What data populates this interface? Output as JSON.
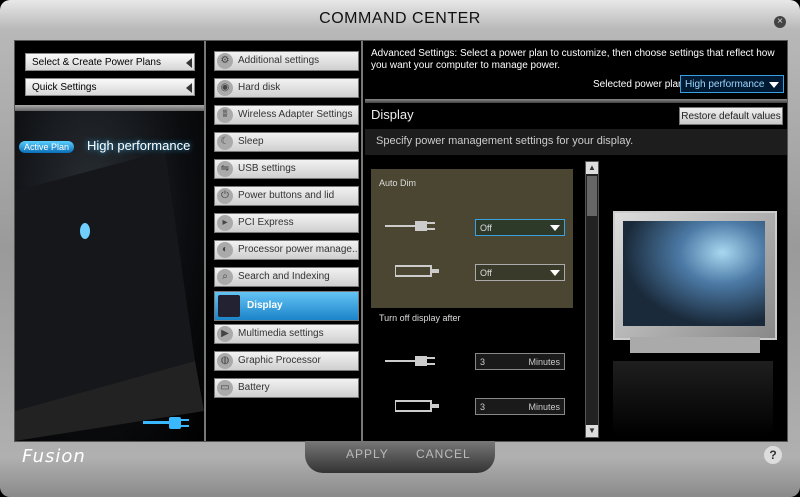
{
  "window": {
    "title": "COMMAND CENTER",
    "close_glyph": "×"
  },
  "left": {
    "buttons": [
      {
        "label": "Select & Create Power Plans"
      },
      {
        "label": "Quick Settings"
      }
    ],
    "active_plan_label": "Active Plan",
    "active_plan_value": "High performance"
  },
  "middle": {
    "items": [
      {
        "label": "Additional settings",
        "icon": "gear-icon"
      },
      {
        "label": "Hard disk",
        "icon": "hard-disk-icon"
      },
      {
        "label": "Wireless Adapter Settings",
        "icon": "wireless-icon"
      },
      {
        "label": "Sleep",
        "icon": "moon-icon"
      },
      {
        "label": "USB settings",
        "icon": "usb-icon"
      },
      {
        "label": "Power buttons and lid",
        "icon": "power-icon"
      },
      {
        "label": "PCI Express",
        "icon": "pci-icon"
      },
      {
        "label": "Processor power manage...",
        "icon": "processor-icon"
      },
      {
        "label": "Search and Indexing",
        "icon": "search-icon"
      },
      {
        "label": "Display",
        "icon": "display-icon",
        "selected": true
      },
      {
        "label": "Multimedia settings",
        "icon": "play-icon"
      },
      {
        "label": "Graphic Processor",
        "icon": "graphics-icon"
      },
      {
        "label": "Battery",
        "icon": "battery-icon"
      }
    ]
  },
  "right": {
    "advanced_text": "Advanced Settings: Select a power plan to customize, then choose settings that reflect how you want your computer to manage power.",
    "selected_plan_label": "Selected power plan",
    "selected_plan_value": "High performance",
    "section_title": "Display",
    "restore_label": "Restore default values",
    "description": "Specify power management settings for your display.",
    "auto_dim": {
      "label": "Auto Dim",
      "plugged_value": "Off",
      "battery_value": "Off"
    },
    "turn_off": {
      "label": "Turn off display after",
      "plugged_value": "3",
      "battery_value": "3",
      "unit": "Minutes"
    }
  },
  "bottom": {
    "logo": "Fusion",
    "apply_label": "APPLY",
    "cancel_label": "CANCEL",
    "help_glyph": "?"
  },
  "colors": {
    "accent": "#1b83c8",
    "panel": "#4a4631"
  }
}
